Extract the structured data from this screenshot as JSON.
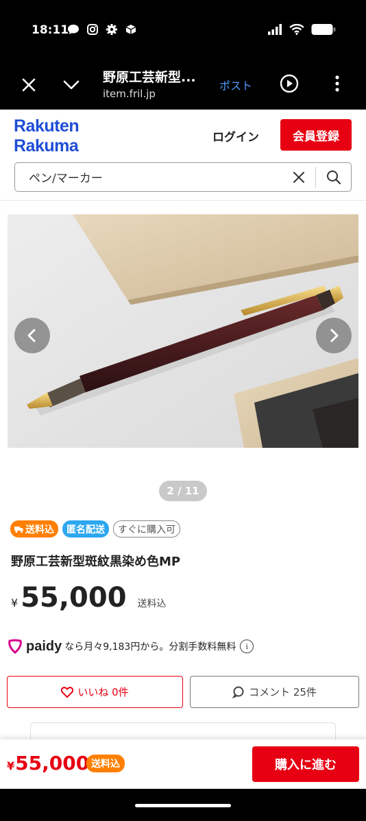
{
  "status_bar": {
    "time": "18:11",
    "left_icons": [
      "chat-bubble-icon",
      "instagram-icon",
      "settings-gear-icon",
      "app-cube-icon"
    ],
    "right_icons": [
      "signal-icon",
      "wifi-icon",
      "battery-icon"
    ]
  },
  "browser": {
    "page_title": "野原工芸新型...",
    "url": "item.fril.jp",
    "post_label": "ポスト"
  },
  "header": {
    "logo_line1": "Rakuten",
    "logo_line2": "Rakuma",
    "login_label": "ログイン",
    "signup_label": "会員登録",
    "search_value": "ペン/マーカー"
  },
  "product": {
    "image_alt": "野原工芸新型斑紋黒染め色MP",
    "page_indicator": "2 / 11",
    "badges": {
      "shipping": "送料込",
      "anonymous": "匿名配送",
      "instant": "すぐに購入可"
    },
    "title": "野原工芸新型斑紋黒染め色MP",
    "price_yen": "¥",
    "price": "55,000",
    "price_note": "送料込",
    "paidy_logo": "paidy",
    "paidy_text": "なら月々9,183円から。分割手数料無料",
    "like_label": "いいね 0件",
    "comment_label": "コメント 25件"
  },
  "buy_bar": {
    "price_yen": "¥",
    "price": "55,000",
    "badge": "送料込",
    "buy_label": "購入に進む"
  },
  "colors": {
    "brand_red": "#e60012",
    "rakuma_blue": "#1f4dd6",
    "shipping_orange": "#ff7f00",
    "anon_blue": "#2da7f0",
    "paidy_pink": "#d6008c"
  }
}
